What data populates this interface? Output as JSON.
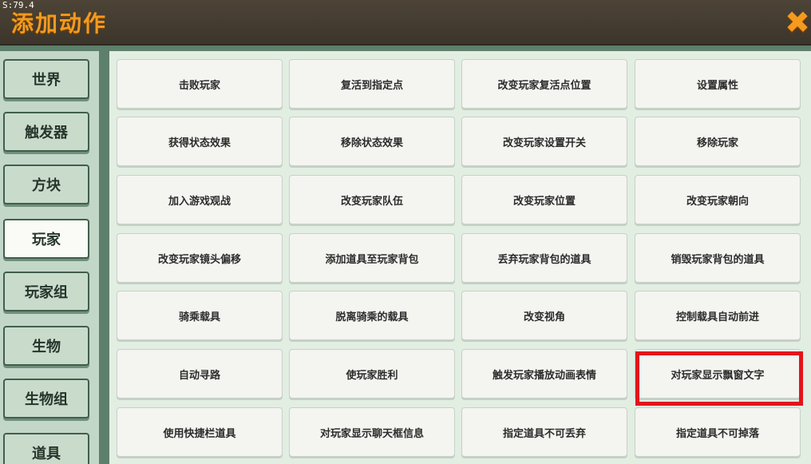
{
  "header": {
    "fps": "S:79.4",
    "title": "添加动作",
    "close_glyph": "✖"
  },
  "sidebar": {
    "items": [
      {
        "label": "世界",
        "active": false
      },
      {
        "label": "触发器",
        "active": false
      },
      {
        "label": "方块",
        "active": false
      },
      {
        "label": "玩家",
        "active": true
      },
      {
        "label": "玩家组",
        "active": false
      },
      {
        "label": "生物",
        "active": false
      },
      {
        "label": "生物组",
        "active": false
      },
      {
        "label": "道具",
        "active": false
      }
    ]
  },
  "actions": [
    "击败玩家",
    "复活到指定点",
    "改变玩家复活点位置",
    "设置属性",
    "获得状态效果",
    "移除状态效果",
    "改变玩家设置开关",
    "移除玩家",
    "加入游戏观战",
    "改变玩家队伍",
    "改变玩家位置",
    "改变玩家朝向",
    "改变玩家镜头偏移",
    "添加道具至玩家背包",
    "丢弃玩家背包的道具",
    "销毁玩家背包的道具",
    "骑乘载具",
    "脱离骑乘的载具",
    "改变视角",
    "控制载具自动前进",
    "自动寻路",
    "使玩家胜利",
    "触发玩家播放动画表情",
    "对玩家显示飘窗文字",
    "使用快捷栏道具",
    "对玩家显示聊天框信息",
    "指定道具不可丢弃",
    "指定道具不可掉落"
  ],
  "colors": {
    "title": "#f39a1f",
    "highlight": "#e3141a"
  }
}
